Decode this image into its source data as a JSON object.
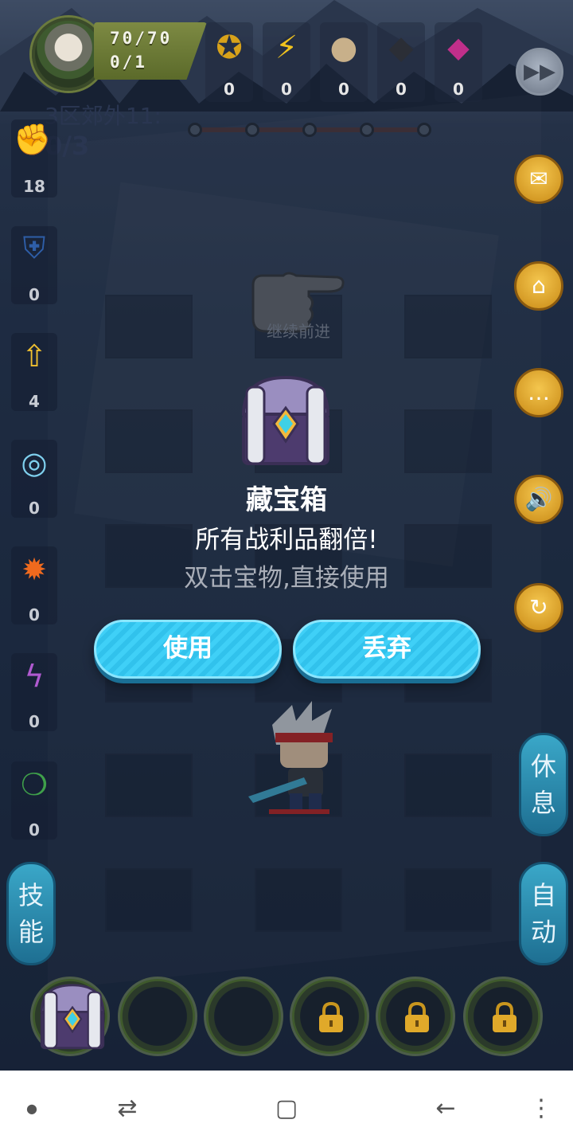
{
  "hud": {
    "hp": "70/70",
    "mana": "0/1",
    "resources": [
      {
        "icon": "gold-coin-icon",
        "value": "0"
      },
      {
        "icon": "lightning-icon",
        "value": "0"
      },
      {
        "icon": "stone-icon",
        "value": "0"
      },
      {
        "icon": "ore-icon",
        "value": "0"
      },
      {
        "icon": "crystal-icon",
        "value": "0"
      }
    ]
  },
  "level": {
    "name": "3区郊外11:",
    "kills": "0/3"
  },
  "left_items": [
    {
      "icon": "fist-icon",
      "value": "18"
    },
    {
      "icon": "shield-icon",
      "value": "0"
    },
    {
      "icon": "fire-arrow-icon",
      "value": "4"
    },
    {
      "icon": "water-swirl-icon",
      "value": "0"
    },
    {
      "icon": "fire-burst-icon",
      "value": "0"
    },
    {
      "icon": "purple-rune-icon",
      "value": "0"
    },
    {
      "icon": "green-ring-icon",
      "value": "0"
    }
  ],
  "right_buttons": [
    "fast-forward-icon",
    "mail-icon",
    "home-icon",
    "chat-icon",
    "sound-icon",
    "refresh-icon"
  ],
  "side": {
    "rest": [
      "休",
      "息"
    ],
    "skill": [
      "技",
      "能"
    ],
    "auto": [
      "自",
      "动"
    ]
  },
  "board": {
    "continue": "继续前进"
  },
  "popup": {
    "title": "藏宝箱",
    "subtitle": "所有战利品翻倍!",
    "hint": "双击宝物,直接使用",
    "use_label": "使用",
    "discard_label": "丢弃"
  },
  "colors": {
    "button": "#3fd0f7",
    "gold_button": "#f4c64e",
    "side_pill": "#3aa7c8"
  }
}
